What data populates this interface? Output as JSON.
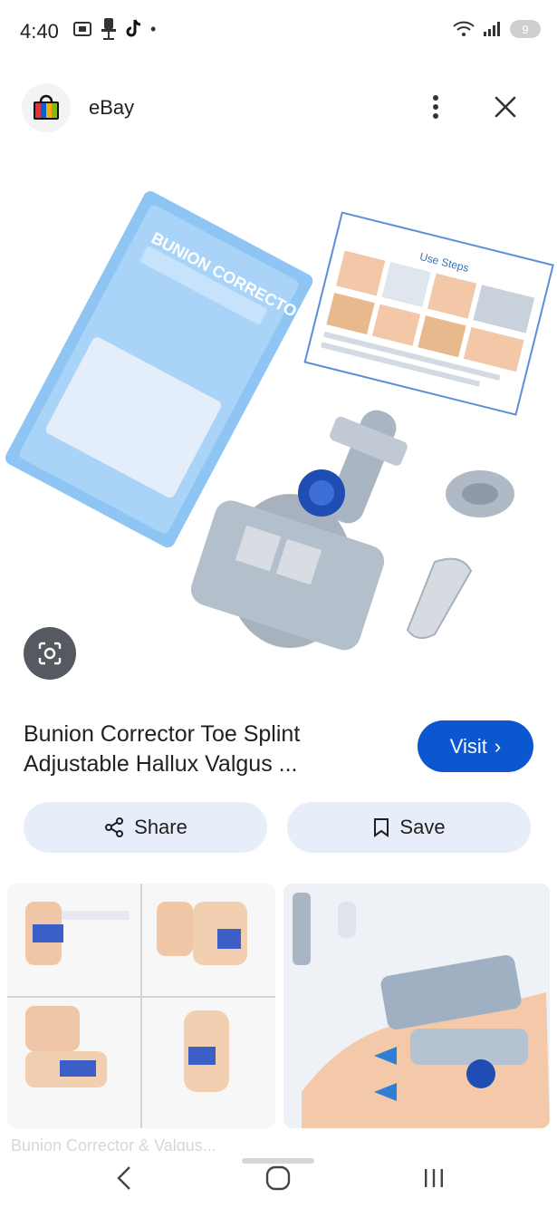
{
  "status_bar": {
    "time": "4:40",
    "battery": "9",
    "notification_dot": "•",
    "icons": [
      "screenshot-icon",
      "chair-icon",
      "tiktok-icon",
      "wifi-icon",
      "signal-icon",
      "battery-icon"
    ]
  },
  "header": {
    "site_name": "eBay",
    "icons": [
      "ebay-logo-icon",
      "more-vert-icon",
      "close-icon"
    ]
  },
  "hero_image": {
    "package_brand_text": "BUNION CORRECTOR",
    "instruction_card_title": "Use Steps"
  },
  "product": {
    "title_line1": "Bunion Corrector Toe Splint",
    "title_line2": "Adjustable Hallux Valgus ...",
    "visit_label": "Visit",
    "visit_arrow": "›"
  },
  "actions": {
    "share_label": "Share",
    "save_label": "Save"
  },
  "related": {
    "caption_left_faded": "Bunion Corrector & Valgus..."
  },
  "colors": {
    "accent_blue": "#0b57d0",
    "pill_bg": "#e8eef9"
  }
}
